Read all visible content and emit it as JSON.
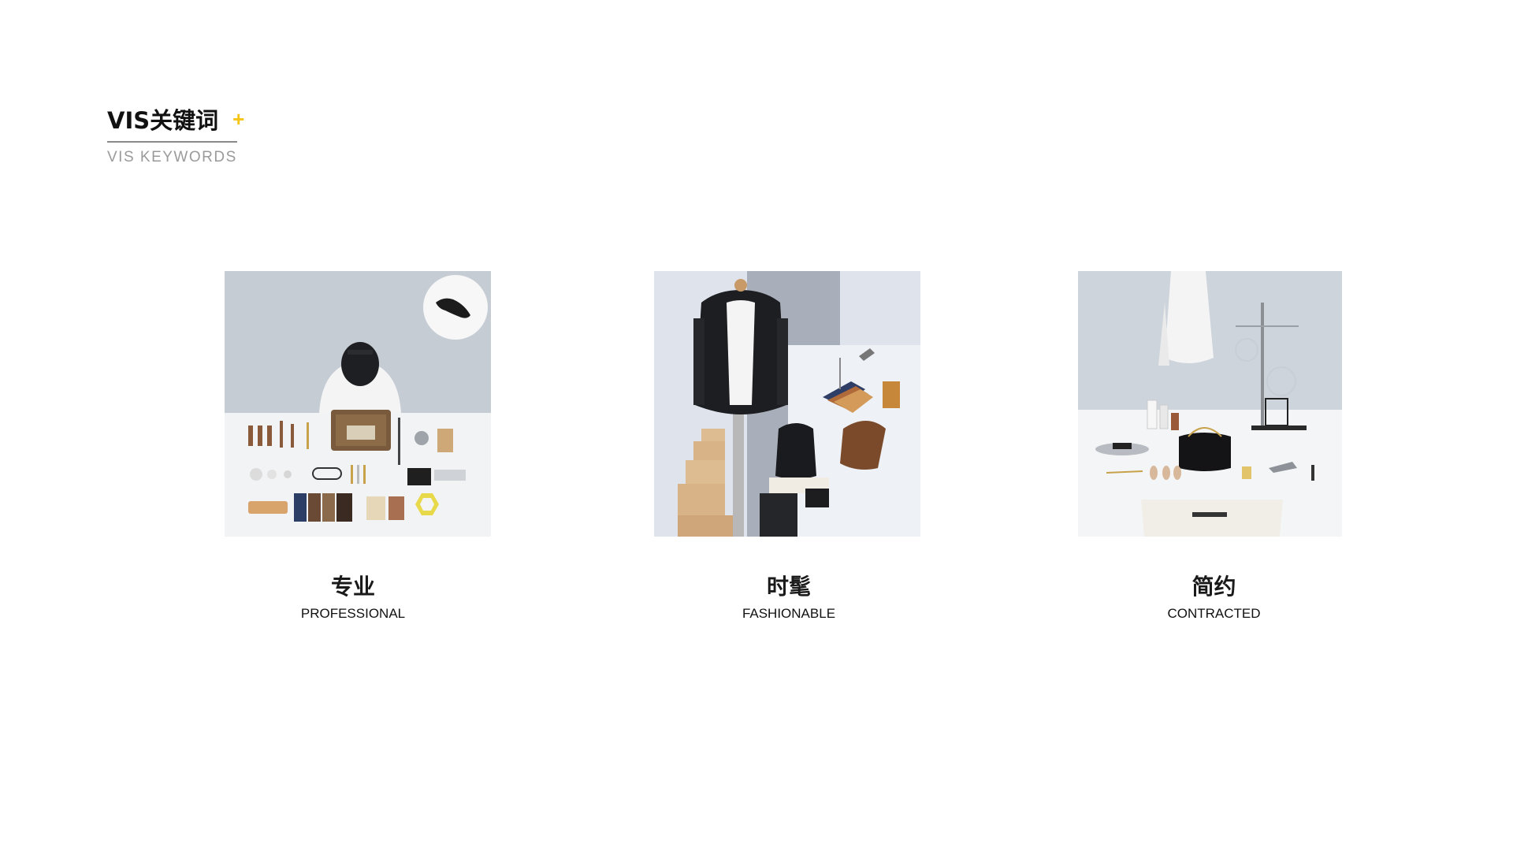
{
  "header": {
    "title": "VIS关键词",
    "plus": "+",
    "subtitle": "VIS KEYWORDS",
    "accent_color": "#f5c518"
  },
  "keywords": [
    {
      "cn": "专业",
      "en": "PROFESSIONAL",
      "image": "professional-flatlay-photo"
    },
    {
      "cn": "时髦",
      "en": "FASHIONABLE",
      "image": "fashionable-mannequin-photo"
    },
    {
      "cn": "简约",
      "en": "CONTRACTED",
      "image": "contracted-lab-photo"
    }
  ]
}
